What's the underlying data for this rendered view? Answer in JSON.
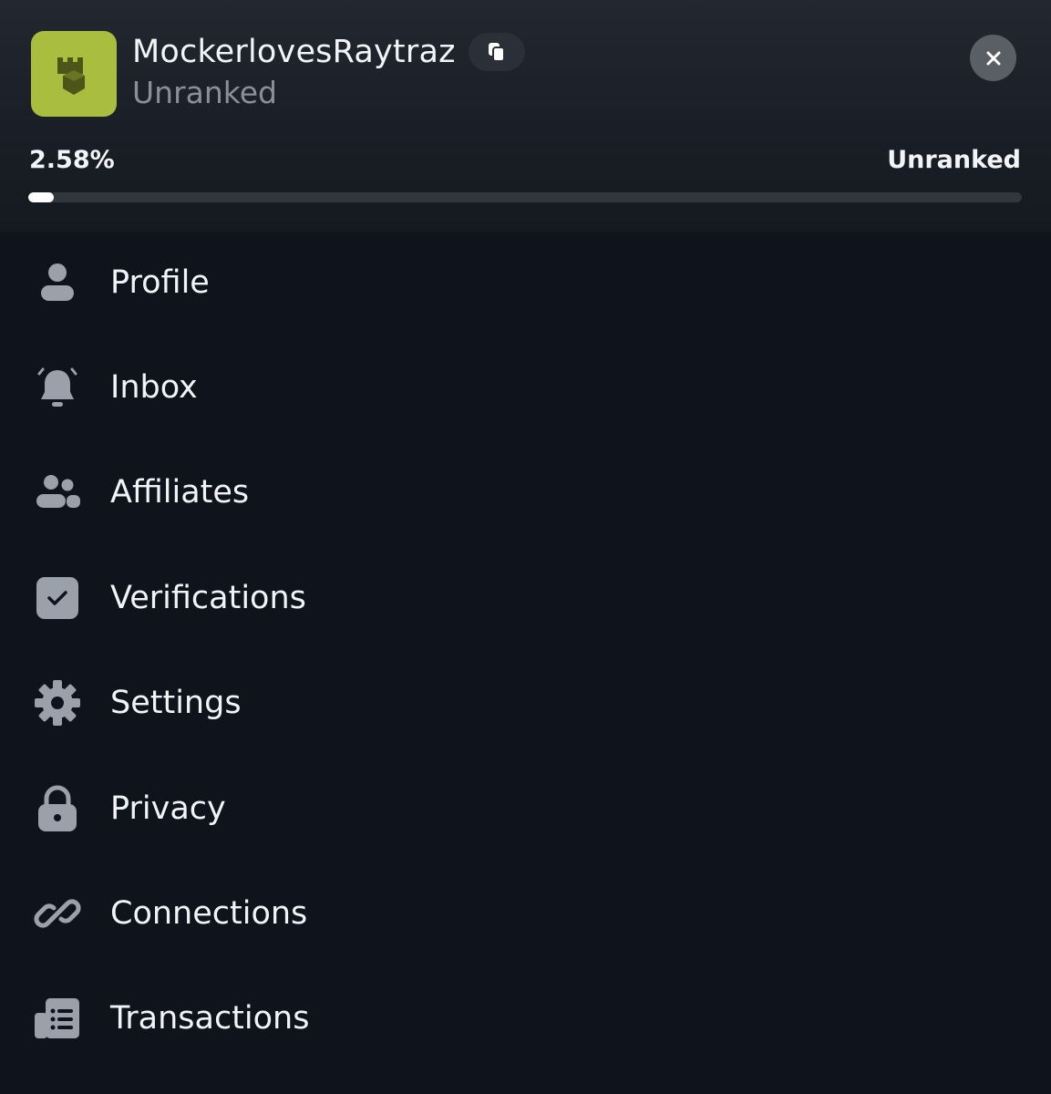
{
  "header": {
    "username": "MockerlovesRaytraz",
    "rank_subtitle": "Unranked",
    "avatar_icon": "castle-icon",
    "avatar_color": "#a9be3e",
    "copy_icon": "copy-icon",
    "close_icon": "close-icon"
  },
  "progress": {
    "percent_label": "2.58%",
    "rank_label": "Unranked",
    "value": 2.58
  },
  "menu": {
    "items": [
      {
        "label": "Profile",
        "icon": "user-icon"
      },
      {
        "label": "Inbox",
        "icon": "bell-icon"
      },
      {
        "label": "Affiliates",
        "icon": "users-icon"
      },
      {
        "label": "Verifications",
        "icon": "checkbox-icon"
      },
      {
        "label": "Settings",
        "icon": "gear-icon"
      },
      {
        "label": "Privacy",
        "icon": "lock-icon"
      },
      {
        "label": "Connections",
        "icon": "link-icon"
      },
      {
        "label": "Transactions",
        "icon": "receipt-icon"
      }
    ]
  },
  "colors": {
    "background": "#0f131c",
    "icon": "#9aa1ab",
    "accent": "#a9be3e"
  }
}
